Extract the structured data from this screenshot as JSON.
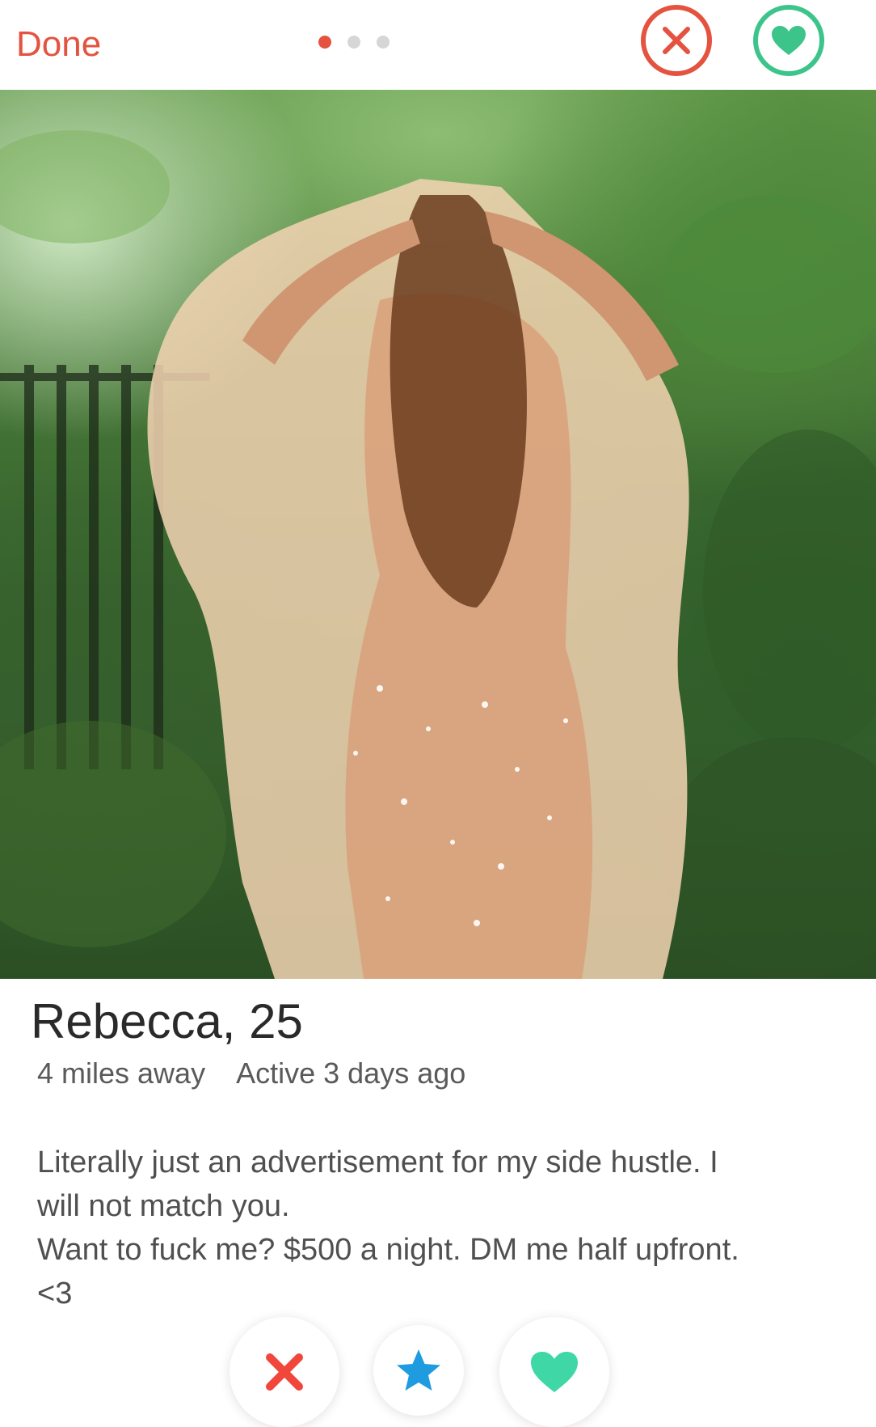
{
  "header": {
    "done_label": "Done",
    "photo_count": 3,
    "active_photo_index": 1
  },
  "profile": {
    "name_age": "Rebecca, 25",
    "distance": "4 miles away",
    "last_active": "Active 3 days ago",
    "bio_lines": [
      "Literally just an advertisement for my side hustle. I",
      "will not match you.",
      "Want to fuck me? $500 a night. DM me half upfront.",
      "<3"
    ]
  },
  "icons": {
    "header_nope": "close-icon",
    "header_like": "heart-icon",
    "action_nope": "x-icon",
    "action_superlike": "star-icon",
    "action_like": "heart-icon"
  },
  "colors": {
    "accent_red": "#e4533f",
    "accent_green": "#3cc48b",
    "star_blue": "#1f9be0",
    "text_primary": "#2a2a2a",
    "text_secondary": "#505050"
  }
}
